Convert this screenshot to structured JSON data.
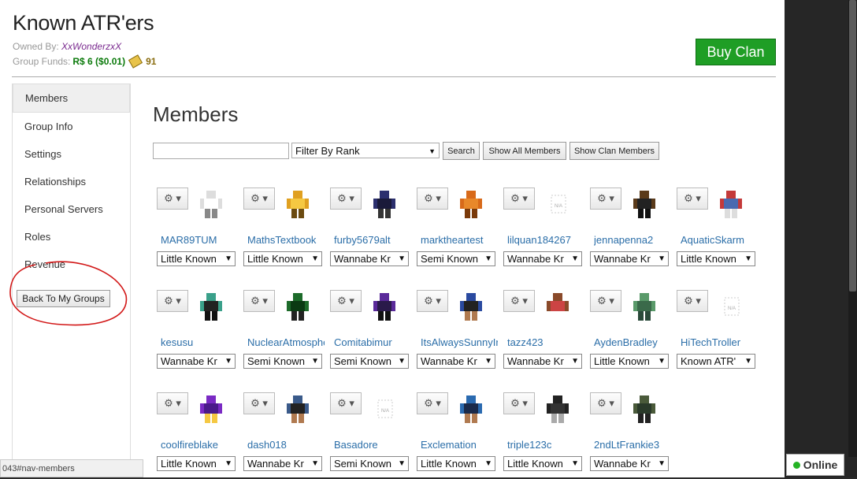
{
  "group": {
    "title": "Known ATR'ers",
    "owned_label": "Owned By:",
    "owner": "XxWonderzxX",
    "funds_label": "Group Funds:",
    "robux": "R$ 6 ($0.01)",
    "tickets": "91",
    "buy_label": "Buy Clan"
  },
  "sidebar": {
    "items": [
      {
        "label": "Members"
      },
      {
        "label": "Group Info"
      },
      {
        "label": "Settings"
      },
      {
        "label": "Relationships"
      },
      {
        "label": "Personal Servers"
      },
      {
        "label": "Roles"
      },
      {
        "label": "Revenue"
      }
    ],
    "back_label": "Back To My Groups"
  },
  "main": {
    "heading": "Members",
    "search_value": "",
    "filter_label": "Filter By Rank",
    "search_label": "Search",
    "show_all_label": "Show All Members",
    "show_clan_label": "Show Clan Members"
  },
  "members": [
    {
      "name": "MAR89TUM",
      "rank": "Little Known",
      "avatar": "white"
    },
    {
      "name": "MathsTextbook",
      "rank": "Little Known",
      "avatar": "gold"
    },
    {
      "name": "furby5679alt",
      "rank": "Wannabe Kr",
      "avatar": "navy"
    },
    {
      "name": "marktheartest",
      "rank": "Semi Known",
      "avatar": "orange"
    },
    {
      "name": "lilquan184267",
      "rank": "Wannabe Kr",
      "avatar": "na"
    },
    {
      "name": "jennapenna2",
      "rank": "Wannabe Kr",
      "avatar": "dark"
    },
    {
      "name": "AquaticSkarm",
      "rank": "Little Known",
      "avatar": "red"
    },
    {
      "name": "kesusu",
      "rank": "Wannabe Kr",
      "avatar": "teal"
    },
    {
      "name": "NuclearAtmosphe",
      "rank": "Semi Known",
      "avatar": "green"
    },
    {
      "name": "Comitabimur",
      "rank": "Semi Known",
      "avatar": "purple"
    },
    {
      "name": "ItsAlwaysSunnyIr",
      "rank": "Wannabe Kr",
      "avatar": "blue"
    },
    {
      "name": "tazz423",
      "rank": "Wannabe Kr",
      "avatar": "brown"
    },
    {
      "name": "AydenBradley",
      "rank": "Little Known",
      "avatar": "greenish"
    },
    {
      "name": "HiTechTroller",
      "rank": "Known ATR'",
      "avatar": "na"
    },
    {
      "name": "coolfireblake",
      "rank": "Little Known",
      "avatar": "violet"
    },
    {
      "name": "dash018",
      "rank": "Wannabe Kr",
      "avatar": "denim"
    },
    {
      "name": "Basadore",
      "rank": "Semi Known",
      "avatar": "na"
    },
    {
      "name": "Exclemation",
      "rank": "Little Known",
      "avatar": "blue2"
    },
    {
      "name": "triple123c",
      "rank": "Little Known",
      "avatar": "black"
    },
    {
      "name": "2ndLtFrankie3",
      "rank": "Wannabe Kr",
      "avatar": "camo"
    }
  ],
  "status_bar": "043#nav-members",
  "online_label": "Online"
}
